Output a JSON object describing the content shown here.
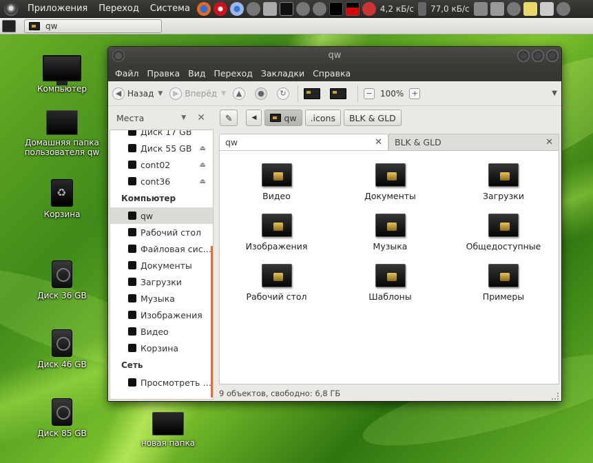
{
  "top_panel": {
    "menus": [
      "Приложения",
      "Переход",
      "Система"
    ],
    "download_speed": "4,2 кБ/с",
    "upload_speed": "77,0 кБ/с"
  },
  "taskbar": {
    "window_button_label": "qw"
  },
  "desktop": {
    "icons": [
      {
        "label": "Компьютер"
      },
      {
        "label": "Домашняя папка пользователя qw"
      },
      {
        "label": "Корзина"
      },
      {
        "label": "Диск 36 GB"
      },
      {
        "label": "Диск 46 GB"
      },
      {
        "label": "Диск 85 GB"
      },
      {
        "label": "новая папка"
      }
    ]
  },
  "window": {
    "title": "qw",
    "menu": [
      "Файл",
      "Правка",
      "Вид",
      "Переход",
      "Закладки",
      "Справка"
    ],
    "toolbar": {
      "back_label": "Назад",
      "forward_label": "Вперёд",
      "zoom": "100%"
    },
    "sidebar": {
      "header": "Места",
      "items": [
        {
          "label": "Диск 17 GB",
          "eject": false
        },
        {
          "label": "Диск 55 GB",
          "eject": true
        },
        {
          "label": "cont02",
          "eject": true
        },
        {
          "label": "cont36",
          "eject": true
        }
      ],
      "section_computer": "Компьютер",
      "computer_items": [
        "qw",
        "Рабочий стол",
        "Файловая сис…",
        "Документы",
        "Загрузки",
        "Музыка",
        "Изображения",
        "Видео",
        "Корзина"
      ],
      "section_network": "Сеть",
      "network_items": [
        "Просмотреть …"
      ]
    },
    "pathbar": [
      "qw",
      ".icons",
      "BLK & GLD"
    ],
    "tabs": [
      {
        "label": "qw"
      },
      {
        "label": "BLK & GLD"
      }
    ],
    "files": [
      "Видео",
      "Документы",
      "Загрузки",
      "Изображения",
      "Музыка",
      "Общедоступные",
      "Рабочий стол",
      "Шаблоны",
      "Примеры"
    ],
    "status": "9 объектов, свободно: 6,8 ГБ"
  },
  "colors": {
    "panel": "#3c3b37",
    "accent_scroll": "#e0703a",
    "desktop_green": "#4a8f1c"
  }
}
